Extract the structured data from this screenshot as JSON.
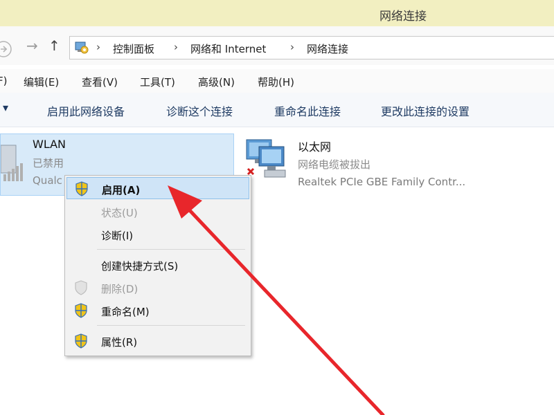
{
  "window": {
    "title": "网络连接"
  },
  "nav": {
    "forward_glyph": "→",
    "up_glyph": "↑"
  },
  "breadcrumb": {
    "separator": "›",
    "items": [
      "控制面板",
      "网络和 Internet",
      "网络连接"
    ]
  },
  "menu": {
    "items": [
      "F)",
      "编辑(E)",
      "查看(V)",
      "工具(T)",
      "高级(N)",
      "帮助(H)"
    ]
  },
  "toolbar": {
    "dropdown_glyph": "▾",
    "items": [
      "启用此网络设备",
      "诊断这个连接",
      "重命名此连接",
      "更改此连接的设置"
    ]
  },
  "connections": [
    {
      "name": "WLAN",
      "status": "已禁用",
      "adapter": "Qualc"
    },
    {
      "name": "以太网",
      "status": "网络电缆被拔出",
      "adapter": "Realtek PCIe GBE Family Contr..."
    }
  ],
  "context_menu": {
    "items": [
      {
        "label": "启用(A)",
        "icon": "shield-icon",
        "state": "highlighted"
      },
      {
        "label": "状态(U)",
        "icon": "",
        "state": "disabled"
      },
      {
        "label": "诊断(I)",
        "icon": "",
        "state": "enabled"
      },
      {
        "label": "创建快捷方式(S)",
        "icon": "",
        "state": "enabled"
      },
      {
        "label": "删除(D)",
        "icon": "shield-icon",
        "state": "disabled"
      },
      {
        "label": "重命名(M)",
        "icon": "shield-icon",
        "state": "enabled"
      },
      {
        "label": "属性(R)",
        "icon": "shield-icon",
        "state": "enabled"
      }
    ]
  },
  "colors": {
    "titlebar": "#f2efc1",
    "selection": "#d8eaf9",
    "menu_highlight": "#cfe4f7",
    "annotation_arrow": "#e8262b"
  }
}
